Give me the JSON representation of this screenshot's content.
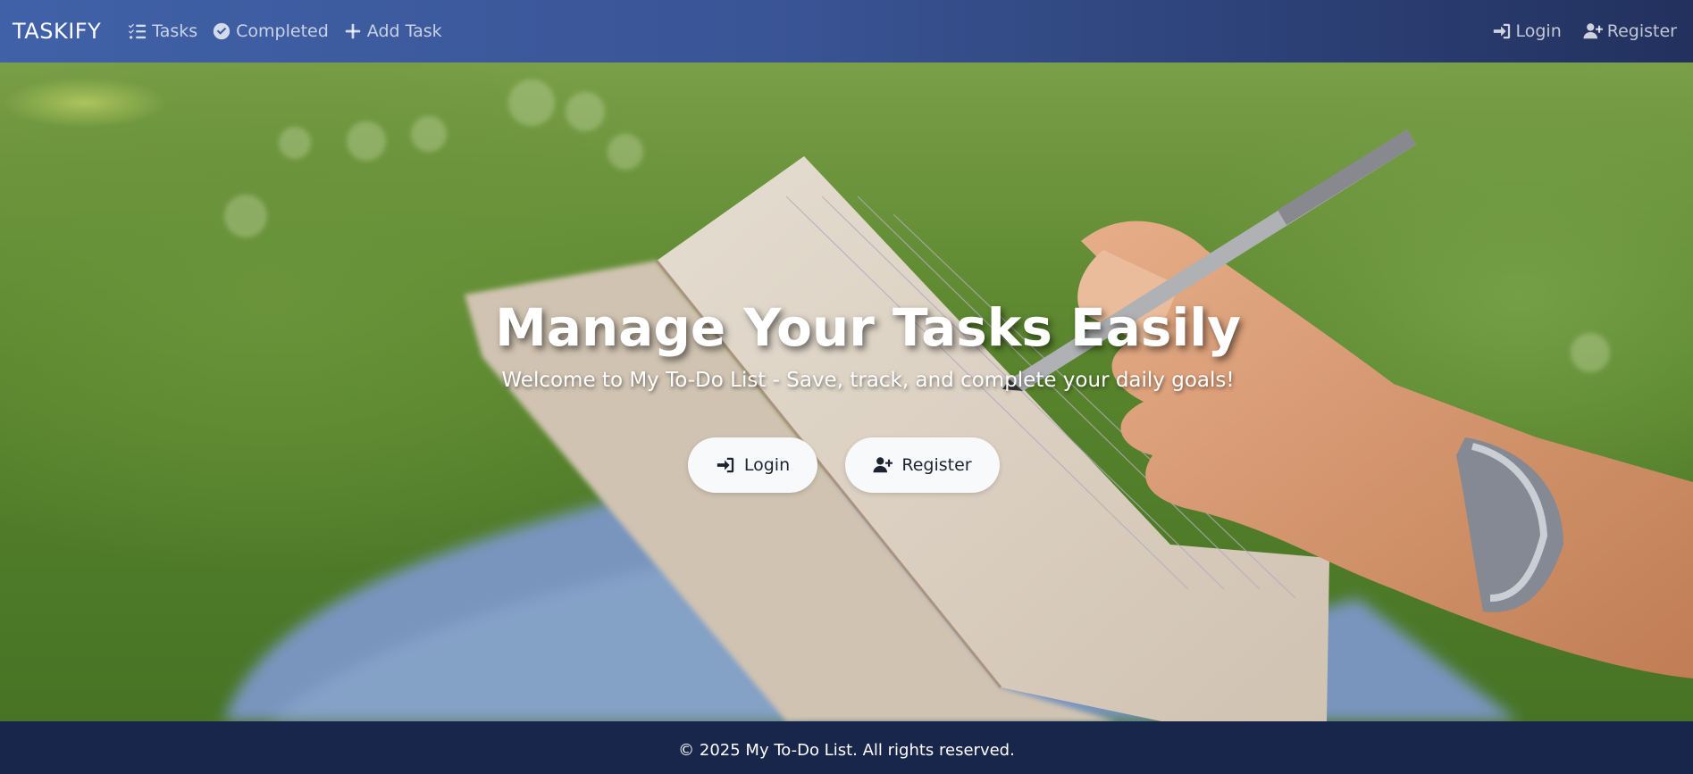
{
  "navbar": {
    "brand": "TASKIFY",
    "links": [
      {
        "label": "Tasks",
        "icon": "task-list-icon"
      },
      {
        "label": "Completed",
        "icon": "check-circle-icon"
      },
      {
        "label": "Add Task",
        "icon": "plus-icon"
      }
    ],
    "auth": [
      {
        "label": "Login",
        "icon": "sign-in-icon"
      },
      {
        "label": "Register",
        "icon": "user-plus-icon"
      }
    ]
  },
  "hero": {
    "title": "Manage Your Tasks Easily",
    "subtitle": "Welcome to My To-Do List - Save, track, and complete your daily goals!",
    "buttons": {
      "login": {
        "label": "Login",
        "icon": "sign-in-icon"
      },
      "register": {
        "label": "Register",
        "icon": "user-plus-icon"
      }
    },
    "background_image": "hand-writing-in-notebook-on-grass-photo"
  },
  "footer": {
    "text": "© 2025 My To-Do List. All rights reserved."
  },
  "colors": {
    "navbar_start": "#4061a8",
    "navbar_end": "#22315e",
    "footer_bg": "#17264a",
    "button_bg": "#f8f9fa"
  }
}
